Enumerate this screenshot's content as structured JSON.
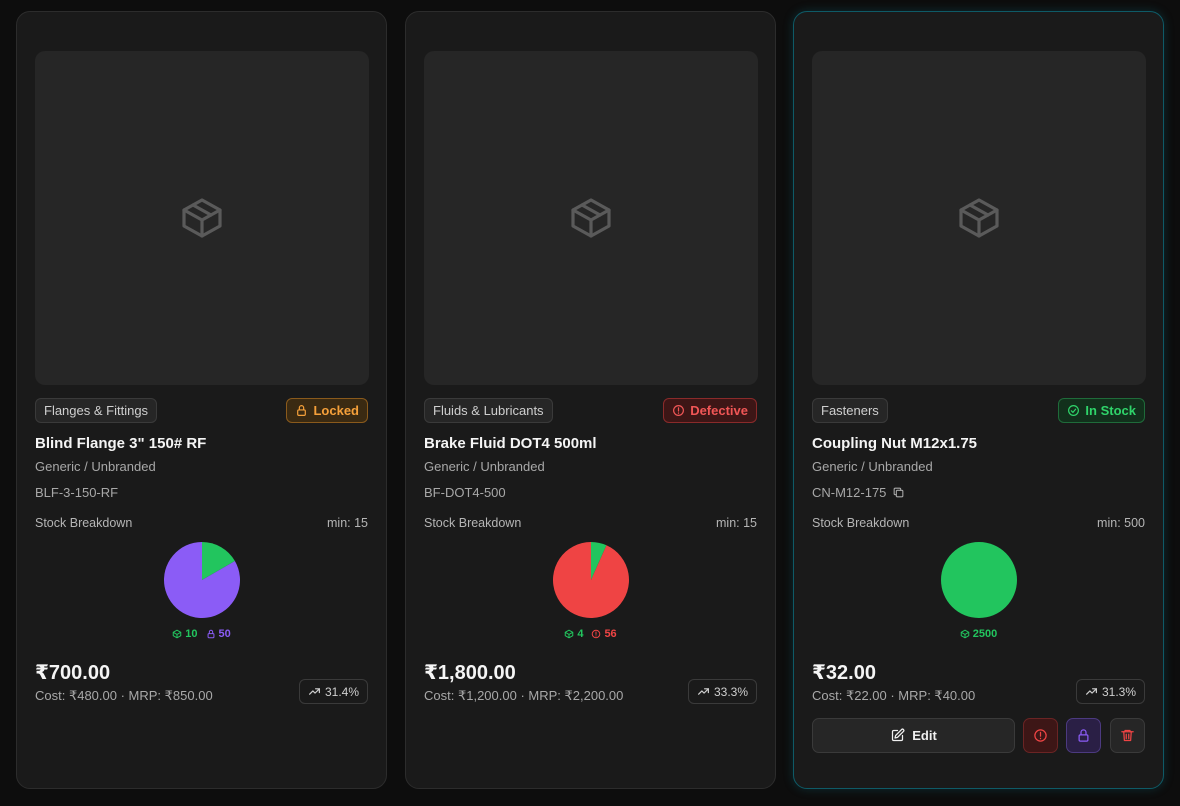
{
  "colors": {
    "locked": "#f5a03a",
    "defective": "#ef4444",
    "in_stock": "#22c55e",
    "reserved": "#8b5cf6"
  },
  "products": [
    {
      "category": "Flanges & Fittings",
      "status": "Locked",
      "status_icon": "lock-icon",
      "title": "Blind Flange 3\" 150# RF",
      "brand": "Generic / Unbranded",
      "sku": "BLF-3-150-RF",
      "stock_label": "Stock Breakdown",
      "min_label": "min: 15",
      "legend": [
        {
          "icon": "box-icon",
          "value": "10",
          "color": "#22c55e"
        },
        {
          "icon": "lock-icon",
          "value": "50",
          "color": "#8b5cf6"
        }
      ],
      "price": "₹700.00",
      "cost_line": "Cost: ₹480.00 · MRP: ₹850.00",
      "margin": "31.4%"
    },
    {
      "category": "Fluids & Lubricants",
      "status": "Defective",
      "status_icon": "alert-circle-icon",
      "title": "Brake Fluid DOT4 500ml",
      "brand": "Generic / Unbranded",
      "sku": "BF-DOT4-500",
      "stock_label": "Stock Breakdown",
      "min_label": "min: 15",
      "legend": [
        {
          "icon": "box-icon",
          "value": "4",
          "color": "#22c55e"
        },
        {
          "icon": "alert-circle-icon",
          "value": "56",
          "color": "#ef4444"
        }
      ],
      "price": "₹1,800.00",
      "cost_line": "Cost: ₹1,200.00 · MRP: ₹2,200.00",
      "margin": "33.3%"
    },
    {
      "category": "Fasteners",
      "status": "In Stock",
      "status_icon": "check-circle-icon",
      "title": "Coupling Nut M12x1.75",
      "brand": "Generic / Unbranded",
      "sku": "CN-M12-175",
      "stock_label": "Stock Breakdown",
      "min_label": "min: 500",
      "legend": [
        {
          "icon": "box-icon",
          "value": "2500",
          "color": "#22c55e"
        }
      ],
      "price": "₹32.00",
      "cost_line": "Cost: ₹22.00 · MRP: ₹40.00",
      "margin": "31.3%",
      "edit_label": "Edit"
    }
  ],
  "chart_data": [
    {
      "type": "pie",
      "slices": [
        {
          "value": 10,
          "color": "#22c55e"
        },
        {
          "value": 50,
          "color": "#8b5cf6"
        }
      ]
    },
    {
      "type": "pie",
      "slices": [
        {
          "value": 4,
          "color": "#22c55e"
        },
        {
          "value": 56,
          "color": "#ef4444"
        }
      ]
    },
    {
      "type": "pie",
      "slices": [
        {
          "value": 2500,
          "color": "#22c55e"
        }
      ]
    }
  ]
}
